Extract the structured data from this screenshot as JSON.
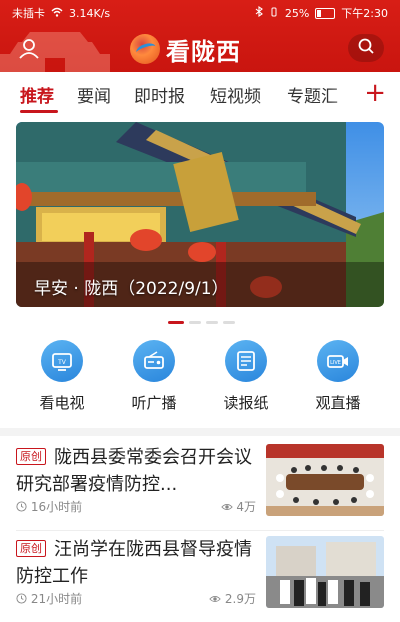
{
  "status_bar": {
    "carrier": "未插卡",
    "speed": "3.14K/s",
    "battery": "25%",
    "time": "下午2:30",
    "battery_level": 0.25
  },
  "header": {
    "app_name": "看陇西",
    "brand_color": "#d81e16",
    "user_icon": "user-icon",
    "search_icon": "search-icon"
  },
  "tabs": [
    {
      "label": "推荐",
      "active": true
    },
    {
      "label": "要闻",
      "active": false
    },
    {
      "label": "即时报",
      "active": false
    },
    {
      "label": "短视频",
      "active": false
    },
    {
      "label": "专题汇",
      "active": false
    }
  ],
  "tab_add_label": "+",
  "banner": {
    "caption": "早安 · 陇西（2022/9/1）",
    "pages": 4,
    "active_page": 1
  },
  "quick_entries": [
    {
      "label": "看电视",
      "icon": "tv-icon"
    },
    {
      "label": "听广播",
      "icon": "radio-icon"
    },
    {
      "label": "读报纸",
      "icon": "newspaper-icon"
    },
    {
      "label": "观直播",
      "icon": "live-camera-icon"
    }
  ],
  "news": [
    {
      "tag": "原创",
      "title": "陇西县委常委会召开会议 研究部署疫情防控...",
      "time": "16小时前",
      "views": "4万"
    },
    {
      "tag": "原创",
      "title": "汪尚学在陇西县督导疫情防控工作",
      "time": "21小时前",
      "views": "2.9万"
    }
  ],
  "accent_color": "#c8161d",
  "icon_color": "#2a86dc"
}
